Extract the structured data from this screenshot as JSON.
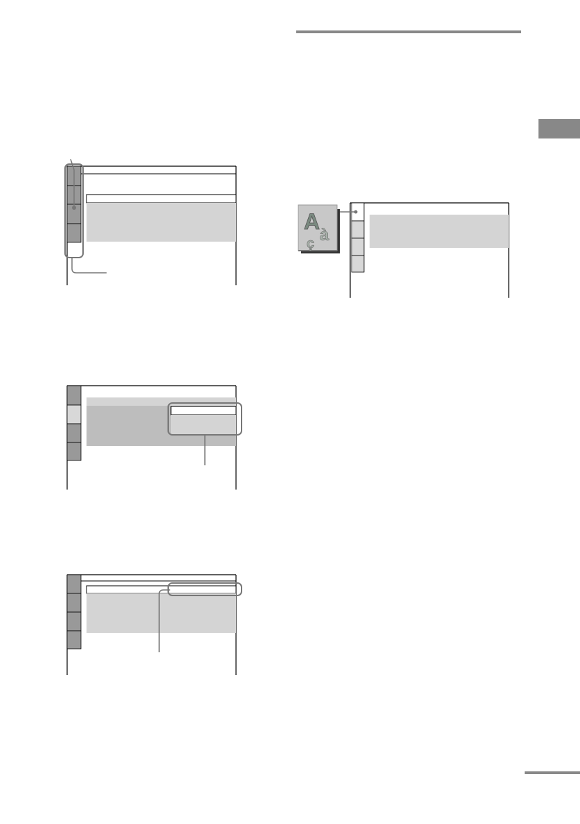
{
  "page": {
    "background": "#ffffff",
    "text": []
  },
  "colors": {
    "ink": "#000000",
    "line_gray": "#777777",
    "tab_dark": "#999999",
    "tab_light": "#d8d8d8",
    "panel_light": "#d4d4d4",
    "panel_mid": "#bdbdbd",
    "page_tab": "#888888",
    "section_rule": "#888888"
  },
  "screens": [
    {
      "name": "setup-display-1",
      "callouts": 2,
      "tabs": 4
    },
    {
      "name": "setup-display-2",
      "callouts": 1,
      "tabs": 4
    },
    {
      "name": "setup-display-3",
      "callouts": 1,
      "tabs": 4
    },
    {
      "name": "language-display",
      "icon": "language-icon",
      "icon_letters": [
        "A",
        "à",
        "ç"
      ],
      "callouts": 1,
      "tabs": 4
    }
  ]
}
